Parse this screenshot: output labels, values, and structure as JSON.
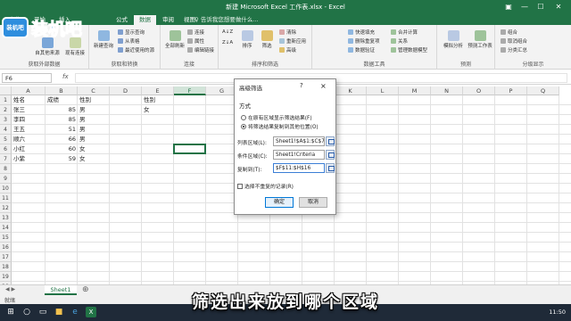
{
  "window": {
    "title": "新建 Microsoft Excel 工作表.xlsx - Excel",
    "accent": "#217346"
  },
  "logo": {
    "badge": "装机吧",
    "text": "装机吧"
  },
  "ribbon": {
    "tabs": [
      {
        "label": "文件"
      },
      {
        "label": "开始"
      },
      {
        "label": "插入"
      },
      {
        "label": "公式"
      },
      {
        "label": "数据"
      },
      {
        "label": "审阅"
      },
      {
        "label": "视图"
      }
    ],
    "active_tab": "数据",
    "tell_me": "♀ 告诉我您想要做什么...",
    "g1": {
      "btn_a": "自其他来源",
      "btn_b": "现有连接",
      "label": "获取外部数据"
    },
    "g2": {
      "btn_new": "新建查询",
      "rows": [
        "显示查询",
        "从表格",
        "最近使用的源"
      ],
      "label": "获取和转换"
    },
    "g3": {
      "btn_refresh": "全部刷新",
      "rows": [
        "连接",
        "属性",
        "编辑链接"
      ],
      "label": "连接"
    },
    "g4": {
      "sort_az": "A↓Z",
      "sort_za": "Z↓A",
      "btn_sort": "排序",
      "btn_filter": "筛选",
      "rows": [
        "清除",
        "重新应用",
        "高级"
      ],
      "label": "排序和筛选"
    },
    "g5": {
      "rows_a": [
        "快速填充",
        "删除重复项",
        "数据验证"
      ],
      "rows_b": [
        "合并计算",
        "关系",
        "管理数据模型"
      ],
      "label": "数据工具"
    },
    "g6": {
      "btn_a": "模拟分析",
      "btn_b": "预测工作表",
      "label": "预测"
    },
    "g7": {
      "rows": [
        "组合",
        "取消组合",
        "分类汇总"
      ],
      "label": "分级显示"
    }
  },
  "formula_bar": {
    "name_box": "F6",
    "fx": "fx",
    "value": ""
  },
  "grid": {
    "columns": [
      "A",
      "B",
      "C",
      "D",
      "E",
      "F",
      "G",
      "H",
      "I",
      "J",
      "K",
      "L",
      "M",
      "N",
      "O",
      "P",
      "Q"
    ],
    "rows": [
      "1",
      "2",
      "3",
      "4",
      "5",
      "6",
      "7",
      "8",
      "9",
      "10",
      "11",
      "12",
      "13",
      "14",
      "15",
      "16",
      "17",
      "18",
      "19",
      "20"
    ],
    "cells": [
      {
        "col": 0,
        "row": 0,
        "text": "姓名"
      },
      {
        "col": 1,
        "row": 0,
        "text": "成绩"
      },
      {
        "col": 2,
        "row": 0,
        "text": "性别"
      },
      {
        "col": 4,
        "row": 0,
        "text": "性别"
      },
      {
        "col": 0,
        "row": 1,
        "text": "张三"
      },
      {
        "col": 1,
        "row": 1,
        "text": "85",
        "num": true
      },
      {
        "col": 2,
        "row": 1,
        "text": "男"
      },
      {
        "col": 4,
        "row": 1,
        "text": "女"
      },
      {
        "col": 0,
        "row": 2,
        "text": "李四"
      },
      {
        "col": 1,
        "row": 2,
        "text": "85",
        "num": true
      },
      {
        "col": 2,
        "row": 2,
        "text": "男"
      },
      {
        "col": 0,
        "row": 3,
        "text": "王五"
      },
      {
        "col": 1,
        "row": 3,
        "text": "51",
        "num": true
      },
      {
        "col": 2,
        "row": 3,
        "text": "男"
      },
      {
        "col": 0,
        "row": 4,
        "text": "顺六"
      },
      {
        "col": 1,
        "row": 4,
        "text": "66",
        "num": true
      },
      {
        "col": 2,
        "row": 4,
        "text": "男"
      },
      {
        "col": 0,
        "row": 5,
        "text": "小红"
      },
      {
        "col": 1,
        "row": 5,
        "text": "60",
        "num": true
      },
      {
        "col": 2,
        "row": 5,
        "text": "女"
      },
      {
        "col": 0,
        "row": 6,
        "text": "小紫"
      },
      {
        "col": 1,
        "row": 6,
        "text": "59",
        "num": true
      },
      {
        "col": 2,
        "row": 6,
        "text": "女"
      }
    ],
    "selected": {
      "col": 5,
      "row": 5
    }
  },
  "dialog": {
    "title": "高级筛选",
    "help": "?",
    "close": "×",
    "section": "方式",
    "option_in_place": "在原有区域显示筛选结果(F)",
    "option_copy": "将筛选结果复制到其他位置(O)",
    "list_range_label": "列表区域(L):",
    "list_range_value": "Sheet1!$A$1:$C$7",
    "criteria_label": "条件区域(C):",
    "criteria_value": "Sheet1!Criteria",
    "copy_to_label": "复制到(T):",
    "copy_to_value": "$F$11:$H$16",
    "unique_label": "选择不重复的记录(R)",
    "ok": "确定",
    "cancel": "取消"
  },
  "sheets": {
    "tab": "Sheet1",
    "add": "⊕",
    "nav": "◀ ▶"
  },
  "status": {
    "ready": "就绪"
  },
  "subtitle": "筛选出来放到哪个区域",
  "taskbar": {
    "time": "11:50"
  }
}
